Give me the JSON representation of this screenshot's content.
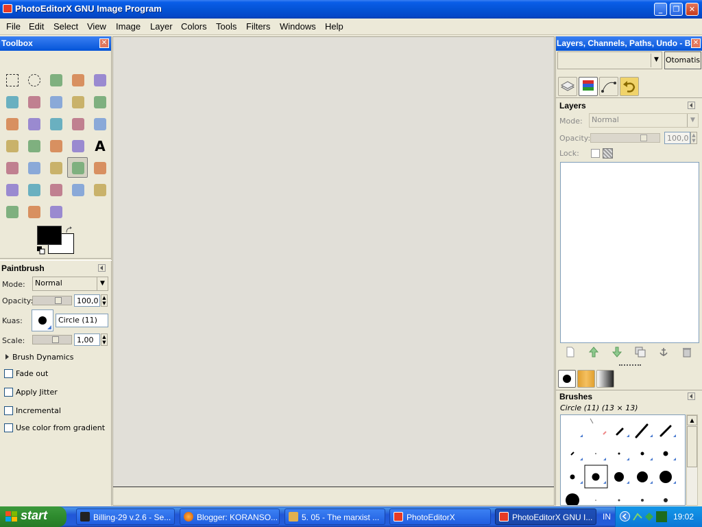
{
  "window": {
    "title": "PhotoEditorX GNU Image Program",
    "minimize": "_",
    "maximize": "❐",
    "close": "✕"
  },
  "menu": [
    "File",
    "Edit",
    "Select",
    "View",
    "Image",
    "Layer",
    "Colors",
    "Tools",
    "Filters",
    "Windows",
    "Help"
  ],
  "toolbox": {
    "title": "Toolbox",
    "close": "✕",
    "tool_icons": [
      "rect-select-icon",
      "ellipse-select-icon",
      "lasso-icon",
      "fuzzy-select-icon",
      "color-select-icon",
      "scissors-icon",
      "foreground-select-icon",
      "paths-icon",
      "color-picker-icon",
      "zoom-icon",
      "measure-icon",
      "move-icon",
      "align-icon",
      "crop-icon",
      "rotate-icon",
      "scale-icon",
      "shear-icon",
      "perspective-icon",
      "flip-icon",
      "text-icon",
      "bucket-fill-icon",
      "blend-icon",
      "pencil-icon",
      "paintbrush-icon",
      "eraser-icon",
      "airbrush-icon",
      "ink-icon",
      "clone-icon",
      "heal-icon",
      "perspective-clone-icon",
      "blur-icon",
      "smudge-icon",
      "dodge-burn-icon"
    ],
    "colors": {
      "foreground": "#000000",
      "background": "#ffffff"
    }
  },
  "tool_options": {
    "title": "Paintbrush",
    "mode_label": "Mode:",
    "mode_value": "Normal",
    "opacity_label": "Opacity:",
    "opacity_value": "100,0",
    "brush_label": "Kuas:",
    "brush_value": "Circle (11)",
    "scale_label": "Scale:",
    "scale_value": "1,00",
    "dynamics": "Brush Dynamics",
    "checks": [
      "Fade out",
      "Apply Jitter",
      "Incremental",
      "Use color from gradient"
    ]
  },
  "dock": {
    "title": "Layers, Channels, Paths, Undo - B...",
    "auto_button": "Otomatis",
    "layers": {
      "title": "Layers",
      "mode_label": "Mode:",
      "mode_value": "Normal",
      "opacity_label": "Opacity:",
      "opacity_value": "100,0",
      "lock_label": "Lock:"
    },
    "brushes": {
      "title": "Brushes",
      "selected": "Circle (11) (13 × 13)"
    }
  },
  "taskbar": {
    "start": "start",
    "items": [
      "Billing-29 v.2.6 - Se...",
      "Blogger: KORANSO...",
      "5. 05 - The marxist ...",
      "PhotoEditorX",
      "PhotoEditorX GNU I..."
    ],
    "lang": "IN",
    "clock": "19:02"
  }
}
